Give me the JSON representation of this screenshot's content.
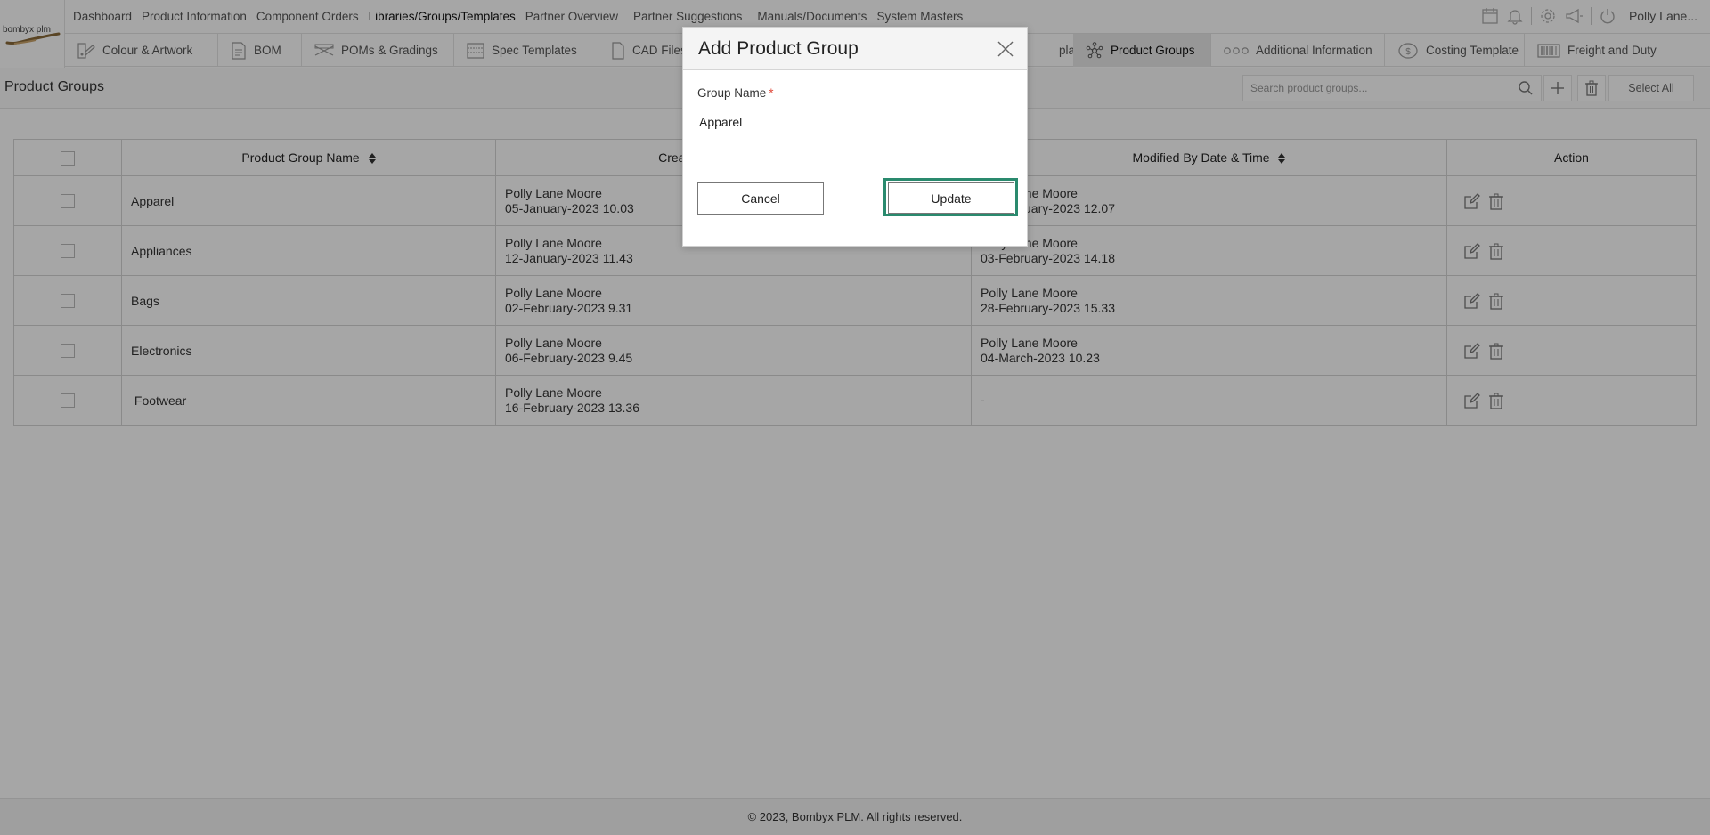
{
  "app": {
    "logo_text": "bombyx plm",
    "user_name": "Polly Lane..."
  },
  "main_nav": [
    {
      "label": "Dashboard"
    },
    {
      "label": "Product Information"
    },
    {
      "label": "Component Orders"
    },
    {
      "label": "Libraries/Groups/Templates",
      "active": true
    },
    {
      "label": "Partner Overview"
    },
    {
      "label": "Partner Suggestions"
    },
    {
      "label": "Manuals/Documents"
    },
    {
      "label": "System Masters"
    }
  ],
  "sub_nav": [
    {
      "label": "Colour & Artwork",
      "icon": "palette-icon"
    },
    {
      "label": "BOM",
      "icon": "document-icon"
    },
    {
      "label": "POMs & Gradings",
      "icon": "ruler-icon"
    },
    {
      "label": "Spec Templates",
      "icon": "grid-icon"
    },
    {
      "label": "CAD Files",
      "icon": "file-icon"
    },
    {
      "label": "plates",
      "icon": ""
    },
    {
      "label": "Product Groups",
      "icon": "network-icon",
      "active": true
    },
    {
      "label": "Additional Information",
      "icon": "circles-icon"
    },
    {
      "label": "Costing Template",
      "icon": "coin-icon"
    },
    {
      "label": "Freight and Duty",
      "icon": "barcode-icon"
    }
  ],
  "page": {
    "title": "Product Groups",
    "search_placeholder": "Search product groups...",
    "select_all_label": "Select All"
  },
  "table": {
    "columns": [
      "Product Group Name",
      "Created By Date & Time",
      "Modified By Date & Time",
      "Action"
    ],
    "rows": [
      {
        "name": "Apparel",
        "created_by": "Polly Lane Moore",
        "created_at": "05-January-2023  10.03",
        "modified_by": "Polly Lane Moore",
        "modified_at": "05-February-2023  12.07"
      },
      {
        "name": "Appliances",
        "created_by": "Polly Lane Moore",
        "created_at": "12-January-2023  11.43",
        "modified_by": "Polly Lane Moore",
        "modified_at": "03-February-2023  14.18"
      },
      {
        "name": "Bags",
        "created_by": "Polly Lane Moore",
        "created_at": "02-February-2023  9.31",
        "modified_by": "Polly Lane Moore",
        "modified_at": "28-February-2023  15.33"
      },
      {
        "name": "Electronics",
        "created_by": "Polly Lane Moore",
        "created_at": "06-February-2023  9.45",
        "modified_by": "Polly Lane Moore",
        "modified_at": "04-March-2023  10.23"
      },
      {
        "name": " Footwear",
        "created_by": "Polly Lane Moore",
        "created_at": "16-February-2023  13.36",
        "modified_by": "",
        "modified_at": "-"
      }
    ]
  },
  "modal": {
    "title": "Add Product Group",
    "field_label": "Group Name",
    "required_mark": "*",
    "field_value": "Apparel",
    "cancel_label": "Cancel",
    "update_label": "Update"
  },
  "footer": {
    "text": "© 2023, Bombyx PLM. All rights reserved."
  },
  "colors": {
    "accent": "#2a8a6e",
    "required": "#e0493a"
  }
}
